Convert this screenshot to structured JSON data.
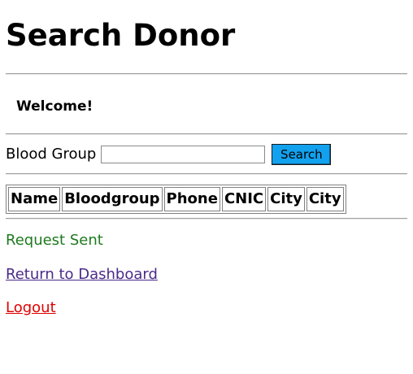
{
  "page": {
    "title": "Search Donor",
    "welcome": "Welcome!"
  },
  "search": {
    "label": "Blood Group",
    "value": "",
    "placeholder": "",
    "button_label": "Search"
  },
  "table": {
    "columns": [
      "Name",
      "Bloodgroup",
      "Phone",
      "CNIC",
      "City",
      "City"
    ]
  },
  "status": {
    "message": "Request Sent",
    "color": "#1f7a1f"
  },
  "links": {
    "dashboard": "Return to Dashboard",
    "logout": "Logout"
  },
  "colors": {
    "button": "#12a1ee",
    "dashboard_link": "#4b2a8a",
    "logout_link": "#e00000"
  }
}
